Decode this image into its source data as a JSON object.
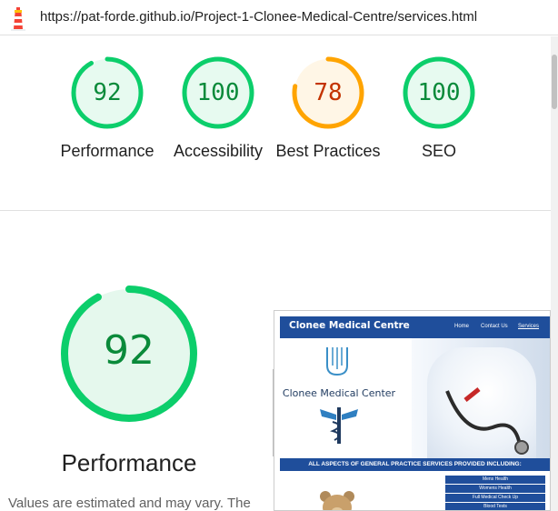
{
  "address_bar": {
    "url": "https://pat-forde.github.io/Project-1-Clonee-Medical-Centre/services.html",
    "icon": "lighthouse-icon"
  },
  "gauges": [
    {
      "score": "92",
      "label": "Performance",
      "fraction": 0.92,
      "color": "#0cce6b",
      "text_color": "#0a8a3a"
    },
    {
      "score": "100",
      "label": "Accessibility",
      "fraction": 1.0,
      "color": "#0cce6b",
      "text_color": "#0a8a3a"
    },
    {
      "score": "78",
      "label": "Best Practices",
      "fraction": 0.78,
      "color": "#ffa400",
      "text_color": "#c33300"
    },
    {
      "score": "100",
      "label": "SEO",
      "fraction": 1.0,
      "color": "#0cce6b",
      "text_color": "#0a8a3a"
    }
  ],
  "performance": {
    "score": "92",
    "fraction": 0.92,
    "title": "Performance",
    "note": "Values are estimated and may vary. The"
  },
  "preview": {
    "brand": "Clonee Medical Centre",
    "nav_links": [
      "Home",
      "Contact Us",
      "Services"
    ],
    "clinic_text": "Clonee Medical Center",
    "banner": "ALL ASPECTS OF GENERAL PRACTICE SERVICES PROVIDED INCLUDING:",
    "services": [
      "Mens Health",
      "Womens Health",
      "Full Medical Check Up",
      "Blood Tests"
    ]
  }
}
